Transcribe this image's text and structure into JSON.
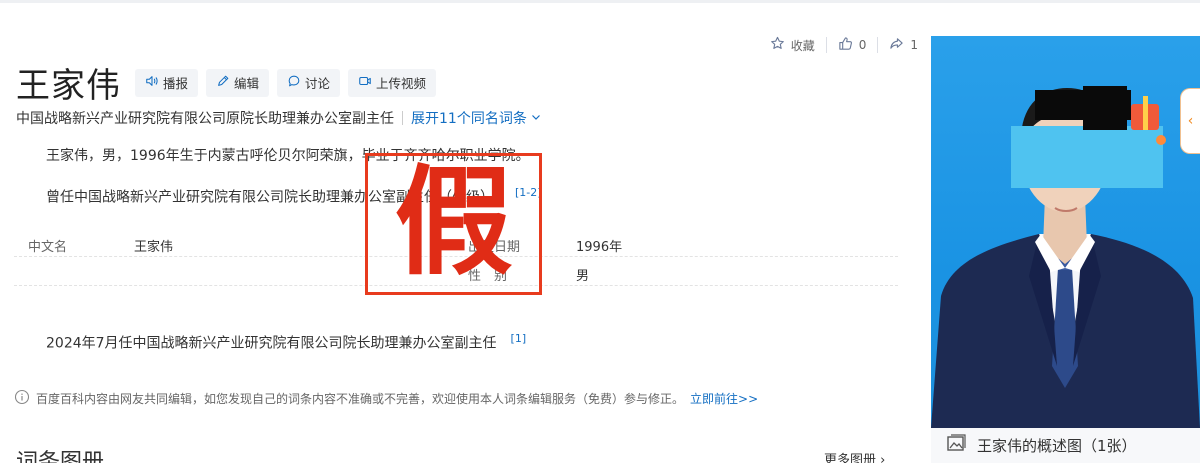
{
  "actions": {
    "collect_label": "收藏",
    "like_count": "0",
    "share_count": "1"
  },
  "entry": {
    "title": "王家伟",
    "buttons": {
      "play": "播报",
      "edit": "编辑",
      "discuss": "讨论",
      "upload_video": "上传视频"
    },
    "subtitle": "中国战略新兴产业研究院有限公司原院长助理兼办公室副主任",
    "expand_label": "展开11个同名词条"
  },
  "summary": {
    "line1": "王家伟，男，1996年生于内蒙古呼伦贝尔阿荣旗，毕业于齐齐哈尔职业学院。",
    "line2": "曾任中国战略新兴产业研究院有限公司院长助理兼办公室副主任（处级）。",
    "line2_ref": "[1-2]"
  },
  "basic_info": {
    "rows": [
      {
        "k1": "中文名",
        "v1": "王家伟",
        "k2": "出生日期",
        "v2": "1996年"
      },
      {
        "k1": "",
        "v1": "",
        "k2": "性　别",
        "v2": "男"
      }
    ]
  },
  "career": {
    "text": "2024年7月任中国战略新兴产业研究院有限公司院长助理兼办公室副主任",
    "ref": "[1]"
  },
  "notice": {
    "text": "百度百科内容由网友共同编辑，如您发现自己的词条内容不准确或不完善，欢迎使用本人词条编辑服务（免费）参与修正。",
    "link": "立即前往>>"
  },
  "album": {
    "title": "词条图册",
    "more": "更多图册"
  },
  "stamp": {
    "char": "假"
  },
  "photo": {
    "caption": "王家伟的概述图（1张）"
  },
  "colors": {
    "link": "#136ec2",
    "stamp": "#e02c16",
    "photo_bg": "#2aa0ea",
    "suit": "#1d2a52"
  },
  "icons": [
    "star-icon",
    "thumb-up-icon",
    "share-icon",
    "speaker-icon",
    "pencil-icon",
    "chat-bubble-icon",
    "video-icon",
    "chevron-down-icon",
    "info-icon",
    "image-icon",
    "chevron-left-icon"
  ]
}
